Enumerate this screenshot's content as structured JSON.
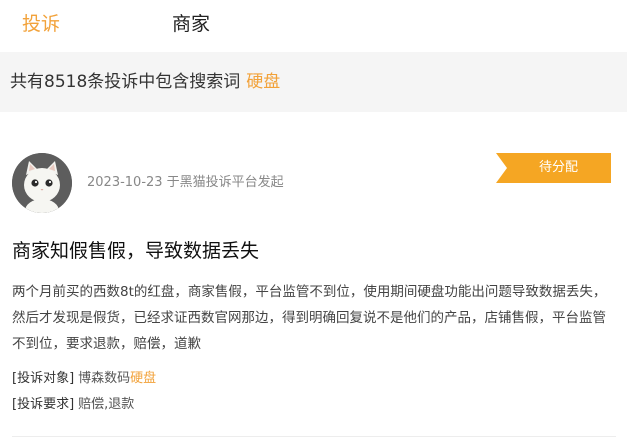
{
  "tabs": [
    {
      "label": "投诉",
      "active": true
    },
    {
      "label": "商家",
      "active": false
    }
  ],
  "summary": {
    "prefix": "共有8518条投诉中包含搜索词",
    "keyword": "硬盘"
  },
  "complaint": {
    "meta": "2023-10-23 于黑猫投诉平台发起",
    "status": "待分配",
    "title": "商家知假售假，导致数据丢失",
    "body": "两个月前买的西数8t的红盘，商家售假，平台监管不到位，使用期间硬盘功能出问题导致数据丢失，然后才发现是假货，已经求证西数官网那边，得到明确回复说不是他们的产品，店铺售假，平台监管不到位，要求退款，赔偿，道歉",
    "target_label": "[投诉对象]",
    "target_value": "博森数码",
    "target_keyword": "硬盘",
    "request_label": "[投诉要求]",
    "request_value": "赔偿,退款"
  },
  "colors": {
    "accent": "#f2a23a",
    "badge": "#f5a623",
    "summary_bg": "#f5f5f5"
  },
  "icons": {
    "avatar": "cat-avatar-icon",
    "badge": "status-ribbon"
  }
}
